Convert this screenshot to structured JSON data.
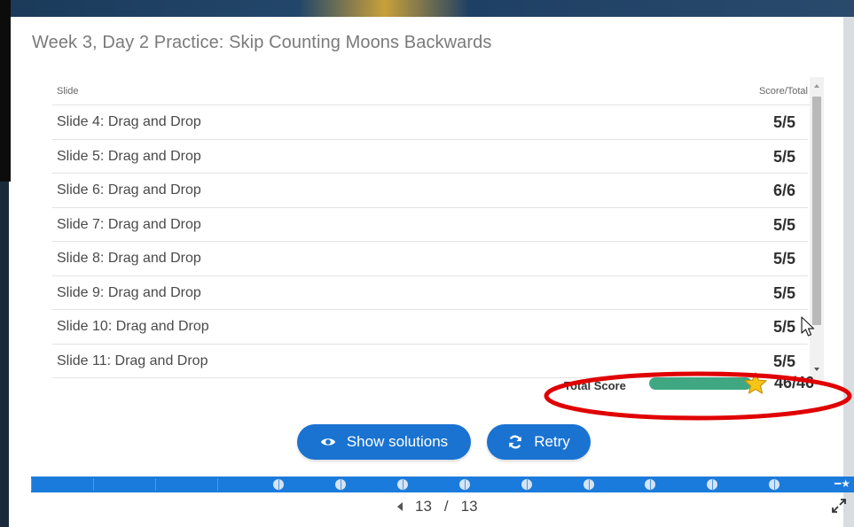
{
  "page": {
    "title": "Week 3, Day 2 Practice: Skip Counting Moons Backwards"
  },
  "table": {
    "headers": {
      "slide": "Slide",
      "score": "Score/Total"
    },
    "rows": [
      {
        "label": "Slide 4: Drag and Drop",
        "score": "5/5"
      },
      {
        "label": "Slide 5: Drag and Drop",
        "score": "5/5"
      },
      {
        "label": "Slide 6: Drag and Drop",
        "score": "6/6"
      },
      {
        "label": "Slide 7: Drag and Drop",
        "score": "5/5"
      },
      {
        "label": "Slide 8: Drag and Drop",
        "score": "5/5"
      },
      {
        "label": "Slide 9: Drag and Drop",
        "score": "5/5"
      },
      {
        "label": "Slide 10: Drag and Drop",
        "score": "5/5"
      },
      {
        "label": "Slide 11: Drag and Drop",
        "score": "5/5"
      }
    ]
  },
  "total": {
    "label": "Total Score",
    "value": "46/46",
    "progress": 1.0
  },
  "buttons": {
    "show_solutions": "Show solutions",
    "retry": "Retry"
  },
  "progress_strip": {
    "slide_count": 13,
    "current": 13
  },
  "navigation": {
    "current": "13",
    "separator": "/",
    "total": "13"
  },
  "colors": {
    "primary": "#1a73d1",
    "progress_fill": "#3fa782",
    "star": "#f5c518",
    "highlight_ellipse": "#e00000"
  },
  "icons": {
    "show_solutions": "eye-icon",
    "retry": "refresh-icon",
    "total": "star-icon",
    "nav_prev": "left-arrow-icon",
    "fullscreen": "fullscreen-icon",
    "cursor": "mouse-pointer-icon"
  }
}
